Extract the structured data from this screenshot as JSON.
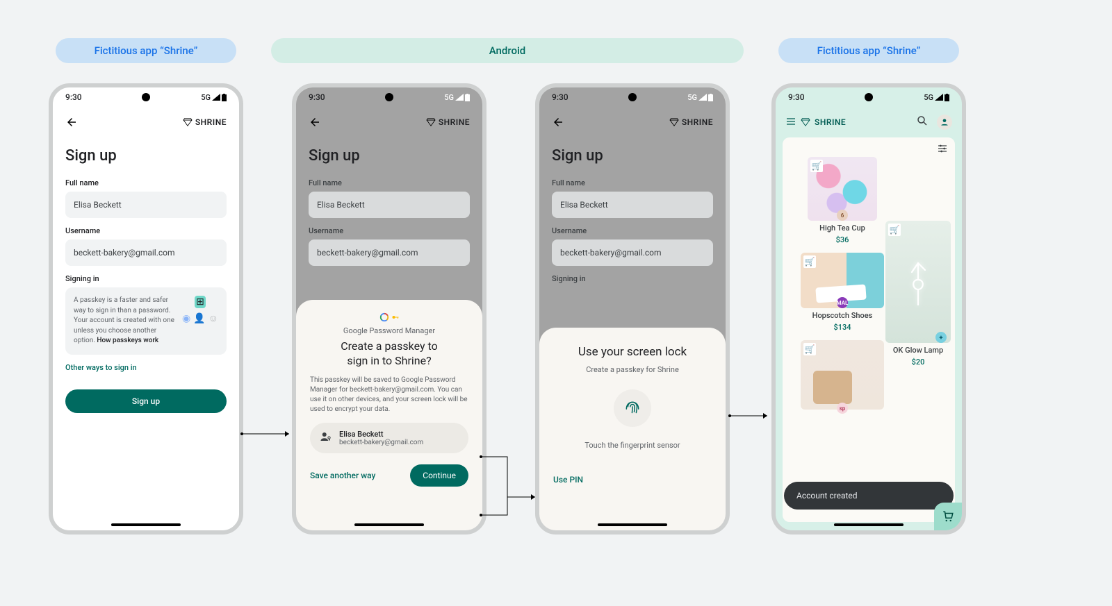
{
  "pills": {
    "left": "Fictitious app “Shrine”",
    "center": "Android",
    "right": "Fictitious app “Shrine”"
  },
  "status": {
    "time": "9:30",
    "network": "5G"
  },
  "brand": "SHRINE",
  "signup": {
    "title": "Sign up",
    "full_name_label": "Full name",
    "full_name_value": "Elisa Beckett",
    "username_label": "Username",
    "username_value": "beckett-bakery@gmail.com",
    "signing_in_label": "Signing in",
    "info_text_1": "A passkey is a faster and safer way to sign in than a password. Your account is created with one unless you choose another option. ",
    "info_link": "How passkeys work",
    "alt_link": "Other ways to sign in",
    "button": "Sign up"
  },
  "gpm": {
    "manager_label": "Google Password Manager",
    "title": "Create a passkey to sign in to Shrine?",
    "desc": "This passkey will be saved to Google Password Manager for beckett-bakery@gmail.com. You can use it on other devices, and your screen lock will be used to encrypt your data.",
    "account_name": "Elisa Beckett",
    "account_email": "beckett-bakery@gmail.com",
    "save_another": "Save another way",
    "continue": "Continue"
  },
  "lock": {
    "title": "Use your screen lock",
    "subtitle": "Create a passkey for Shrine",
    "hint": "Touch the fingerprint sensor",
    "use_pin": "Use PIN"
  },
  "store": {
    "snackbar": "Account created",
    "products": {
      "tea": {
        "name": "High Tea Cup",
        "price": "$36"
      },
      "shoes": {
        "name": "Hopscotch Shoes",
        "price": "$134"
      },
      "lamp": {
        "name": "OK Glow Lamp",
        "price": "$20"
      }
    }
  }
}
